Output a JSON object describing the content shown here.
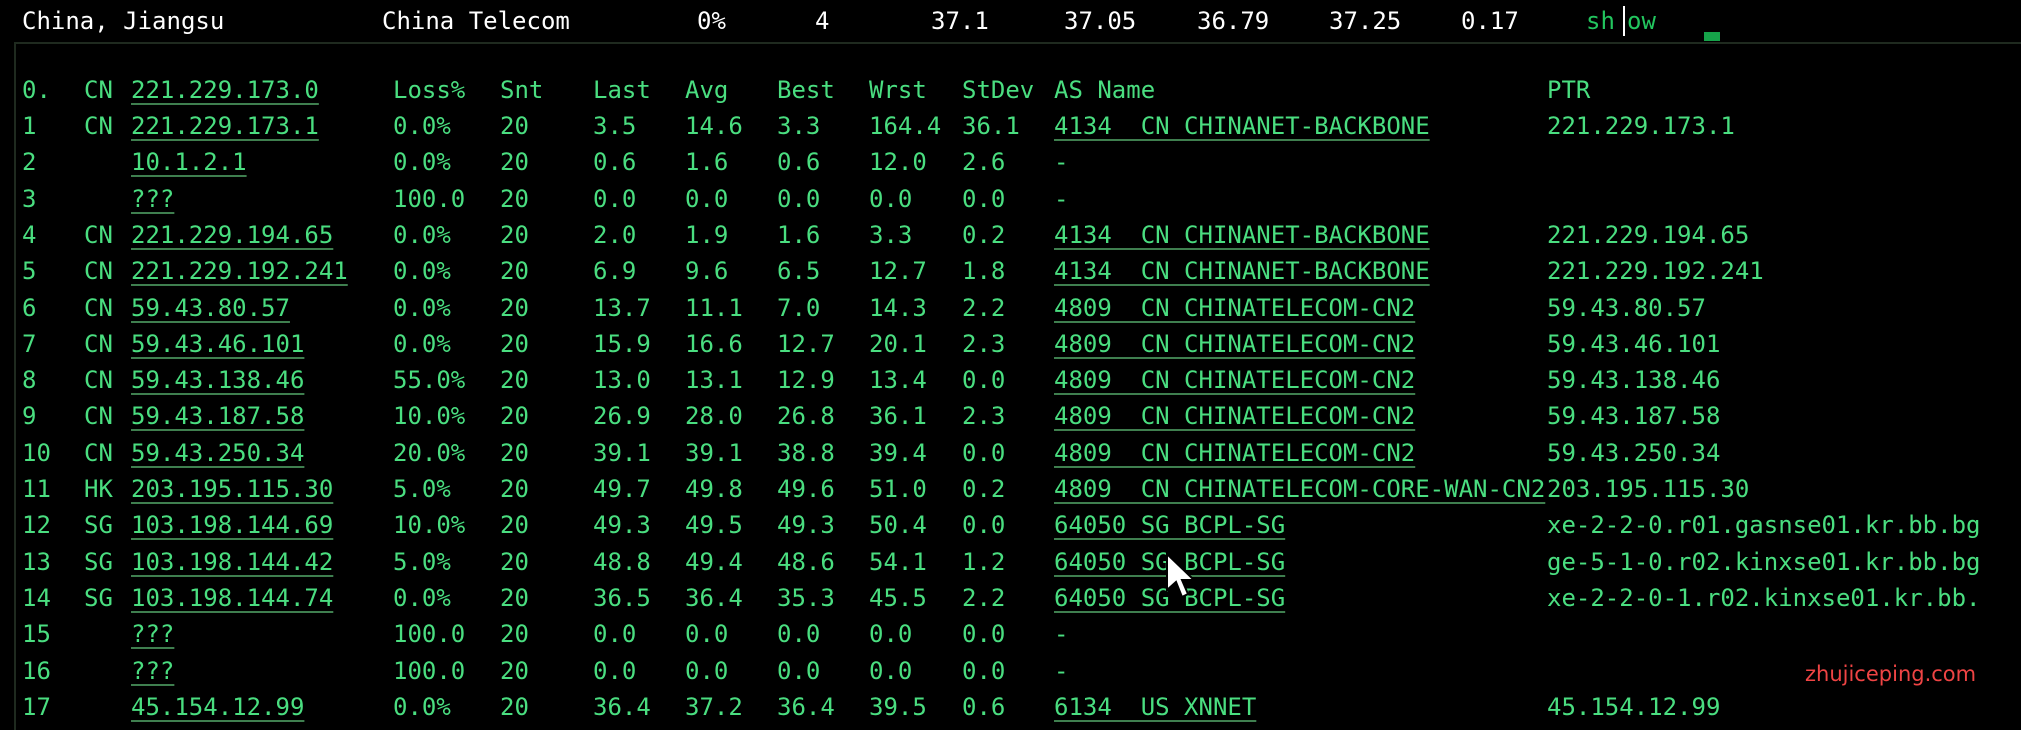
{
  "summary": {
    "location": "China, Jiangsu",
    "isp": "China Telecom",
    "loss": "0%",
    "sent": "4",
    "last": "37.1",
    "avg": "37.05",
    "best": "36.79",
    "worst": "37.25",
    "stdev": "0.17",
    "action_prefix": "sh",
    "action_suffix": "ow"
  },
  "table": {
    "headers": {
      "idx": "0.",
      "cc": "CN",
      "host": "221.229.173.0",
      "loss": "Loss%",
      "snt": "Snt",
      "last": "Last",
      "avg": "Avg",
      "best": "Best",
      "wrst": "Wrst",
      "stdev": "StDev",
      "as": "AS Name",
      "ptr": "PTR"
    },
    "rows": [
      {
        "idx": "1",
        "cc": "CN",
        "ip": "221.229.173.1",
        "loss": "0.0%",
        "snt": "20",
        "last": "3.5",
        "avg": "14.6",
        "best": "3.3",
        "wrst": "164.4",
        "stdev": "36.1",
        "as": "4134  CN CHINANET-BACKBONE",
        "ptr": "221.229.173.1"
      },
      {
        "idx": "2",
        "cc": "",
        "ip": "10.1.2.1",
        "loss": "0.0%",
        "snt": "20",
        "last": "0.6",
        "avg": "1.6",
        "best": "0.6",
        "wrst": "12.0",
        "stdev": "2.6",
        "as": "-",
        "ptr": ""
      },
      {
        "idx": "3",
        "cc": "",
        "ip": "???",
        "loss": "100.0",
        "snt": "20",
        "last": "0.0",
        "avg": "0.0",
        "best": "0.0",
        "wrst": "0.0",
        "stdev": "0.0",
        "as": "-",
        "ptr": ""
      },
      {
        "idx": "4",
        "cc": "CN",
        "ip": "221.229.194.65",
        "loss": "0.0%",
        "snt": "20",
        "last": "2.0",
        "avg": "1.9",
        "best": "1.6",
        "wrst": "3.3",
        "stdev": "0.2",
        "as": "4134  CN CHINANET-BACKBONE",
        "ptr": "221.229.194.65"
      },
      {
        "idx": "5",
        "cc": "CN",
        "ip": "221.229.192.241",
        "loss": "0.0%",
        "snt": "20",
        "last": "6.9",
        "avg": "9.6",
        "best": "6.5",
        "wrst": "12.7",
        "stdev": "1.8",
        "as": "4134  CN CHINANET-BACKBONE",
        "ptr": "221.229.192.241"
      },
      {
        "idx": "6",
        "cc": "CN",
        "ip": "59.43.80.57",
        "loss": "0.0%",
        "snt": "20",
        "last": "13.7",
        "avg": "11.1",
        "best": "7.0",
        "wrst": "14.3",
        "stdev": "2.2",
        "as": "4809  CN CHINATELECOM-CN2",
        "ptr": "59.43.80.57"
      },
      {
        "idx": "7",
        "cc": "CN",
        "ip": "59.43.46.101",
        "loss": "0.0%",
        "snt": "20",
        "last": "15.9",
        "avg": "16.6",
        "best": "12.7",
        "wrst": "20.1",
        "stdev": "2.3",
        "as": "4809  CN CHINATELECOM-CN2",
        "ptr": "59.43.46.101"
      },
      {
        "idx": "8",
        "cc": "CN",
        "ip": "59.43.138.46",
        "loss": "55.0%",
        "snt": "20",
        "last": "13.0",
        "avg": "13.1",
        "best": "12.9",
        "wrst": "13.4",
        "stdev": "0.0",
        "as": "4809  CN CHINATELECOM-CN2",
        "ptr": "59.43.138.46"
      },
      {
        "idx": "9",
        "cc": "CN",
        "ip": "59.43.187.58",
        "loss": "10.0%",
        "snt": "20",
        "last": "26.9",
        "avg": "28.0",
        "best": "26.8",
        "wrst": "36.1",
        "stdev": "2.3",
        "as": "4809  CN CHINATELECOM-CN2",
        "ptr": "59.43.187.58"
      },
      {
        "idx": "10",
        "cc": "CN",
        "ip": "59.43.250.34",
        "loss": "20.0%",
        "snt": "20",
        "last": "39.1",
        "avg": "39.1",
        "best": "38.8",
        "wrst": "39.4",
        "stdev": "0.0",
        "as": "4809  CN CHINATELECOM-CN2",
        "ptr": "59.43.250.34"
      },
      {
        "idx": "11",
        "cc": "HK",
        "ip": "203.195.115.30",
        "loss": "5.0%",
        "snt": "20",
        "last": "49.7",
        "avg": "49.8",
        "best": "49.6",
        "wrst": "51.0",
        "stdev": "0.2",
        "as": "4809  CN CHINATELECOM-CORE-WAN-CN2",
        "ptr": "203.195.115.30"
      },
      {
        "idx": "12",
        "cc": "SG",
        "ip": "103.198.144.69",
        "loss": "10.0%",
        "snt": "20",
        "last": "49.3",
        "avg": "49.5",
        "best": "49.3",
        "wrst": "50.4",
        "stdev": "0.0",
        "as": "64050 SG BCPL-SG",
        "ptr": "xe-2-2-0.r01.gasnse01.kr.bb.bg"
      },
      {
        "idx": "13",
        "cc": "SG",
        "ip": "103.198.144.42",
        "loss": "5.0%",
        "snt": "20",
        "last": "48.8",
        "avg": "49.4",
        "best": "48.6",
        "wrst": "54.1",
        "stdev": "1.2",
        "as": "64050 SG BCPL-SG",
        "ptr": "ge-5-1-0.r02.kinxse01.kr.bb.bg"
      },
      {
        "idx": "14",
        "cc": "SG",
        "ip": "103.198.144.74",
        "loss": "0.0%",
        "snt": "20",
        "last": "36.5",
        "avg": "36.4",
        "best": "35.3",
        "wrst": "45.5",
        "stdev": "2.2",
        "as": "64050 SG BCPL-SG",
        "ptr": "xe-2-2-0-1.r02.kinxse01.kr.bb."
      },
      {
        "idx": "15",
        "cc": "",
        "ip": "???",
        "loss": "100.0",
        "snt": "20",
        "last": "0.0",
        "avg": "0.0",
        "best": "0.0",
        "wrst": "0.0",
        "stdev": "0.0",
        "as": "-",
        "ptr": ""
      },
      {
        "idx": "16",
        "cc": "",
        "ip": "???",
        "loss": "100.0",
        "snt": "20",
        "last": "0.0",
        "avg": "0.0",
        "best": "0.0",
        "wrst": "0.0",
        "stdev": "0.0",
        "as": "-",
        "ptr": ""
      },
      {
        "idx": "17",
        "cc": "",
        "ip": "45.154.12.99",
        "loss": "0.0%",
        "snt": "20",
        "last": "36.4",
        "avg": "37.2",
        "best": "36.4",
        "wrst": "39.5",
        "stdev": "0.6",
        "as": "6134  US XNNET",
        "ptr": "45.154.12.99"
      }
    ]
  },
  "watermark": "zhujiceping.com",
  "colors": {
    "background": "#000000",
    "text_green": "#4ade80",
    "summary_text": "#ffffff",
    "watermark": "#ef4444"
  },
  "icons": [
    "mouse-pointer-icon"
  ]
}
